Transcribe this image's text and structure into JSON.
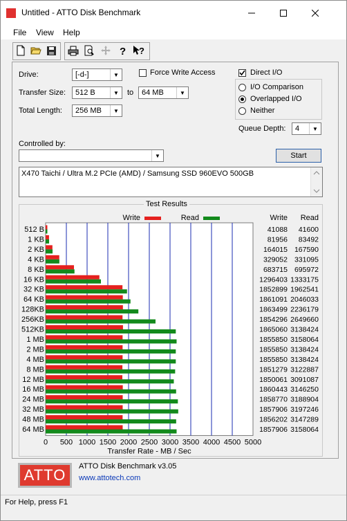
{
  "window": {
    "title": "Untitled - ATTO Disk Benchmark"
  },
  "menu": [
    "File",
    "View",
    "Help"
  ],
  "settings": {
    "drive_label": "Drive:",
    "drive_value": "[-d-]",
    "transfer_size_label": "Transfer Size:",
    "transfer_from": "512 B",
    "to_label": "to",
    "transfer_to": "64 MB",
    "total_length_label": "Total Length:",
    "total_length": "256 MB",
    "force_write_access": "Force Write Access",
    "direct_io": "Direct I/O",
    "io_comparison": "I/O Comparison",
    "overlapped_io": "Overlapped I/O",
    "neither": "Neither",
    "queue_depth_label": "Queue Depth:",
    "queue_depth": "4",
    "controlled_by_label": "Controlled by:",
    "start_button": "Start",
    "description": "X470 Taichi / Ultra M.2 PCIe (AMD) / Samsung SSD 960EVO 500GB"
  },
  "results": {
    "title": "Test Results",
    "write_label": "Write",
    "read_label": "Read",
    "write_col": "Write",
    "read_col": "Read",
    "xlabel": "Transfer Rate - MB / Sec"
  },
  "chart_data": {
    "type": "bar",
    "categories": [
      "512 B",
      "1 KB",
      "2 KB",
      "4 KB",
      "8 KB",
      "16 KB",
      "32 KB",
      "64 KB",
      "128KB",
      "256KB",
      "512KB",
      "1 MB",
      "2 MB",
      "4 MB",
      "8 MB",
      "12 MB",
      "16 MB",
      "24 MB",
      "32 MB",
      "48 MB",
      "64 MB"
    ],
    "series": [
      {
        "name": "Write",
        "color": "#e5211f",
        "values": [
          41088,
          81956,
          164015,
          329052,
          683715,
          1296403,
          1852899,
          1861091,
          1863499,
          1854296,
          1865060,
          1855850,
          1855850,
          1855850,
          1851279,
          1850061,
          1860443,
          1858770,
          1857906,
          1856202,
          1857906
        ]
      },
      {
        "name": "Read",
        "color": "#138a1c",
        "values": [
          41600,
          83492,
          167590,
          331095,
          695972,
          1333175,
          1962541,
          2046033,
          2236179,
          2649660,
          3138424,
          3158064,
          3138424,
          3138424,
          3122887,
          3091087,
          3146250,
          3188904,
          3197246,
          3147289,
          3158064
        ]
      }
    ],
    "xticks": [
      "0",
      "500",
      "1000",
      "1500",
      "2000",
      "2500",
      "3000",
      "3500",
      "4000",
      "4500",
      "5000"
    ],
    "xlim": [
      0,
      5000
    ],
    "value_unit_divisor": 1000,
    "grid": true,
    "legend": "top"
  },
  "footer": {
    "logo": "ATTO",
    "app_version": "ATTO Disk Benchmark v3.05",
    "url": "www.attotech.com"
  },
  "status": {
    "text": "For Help, press F1"
  }
}
